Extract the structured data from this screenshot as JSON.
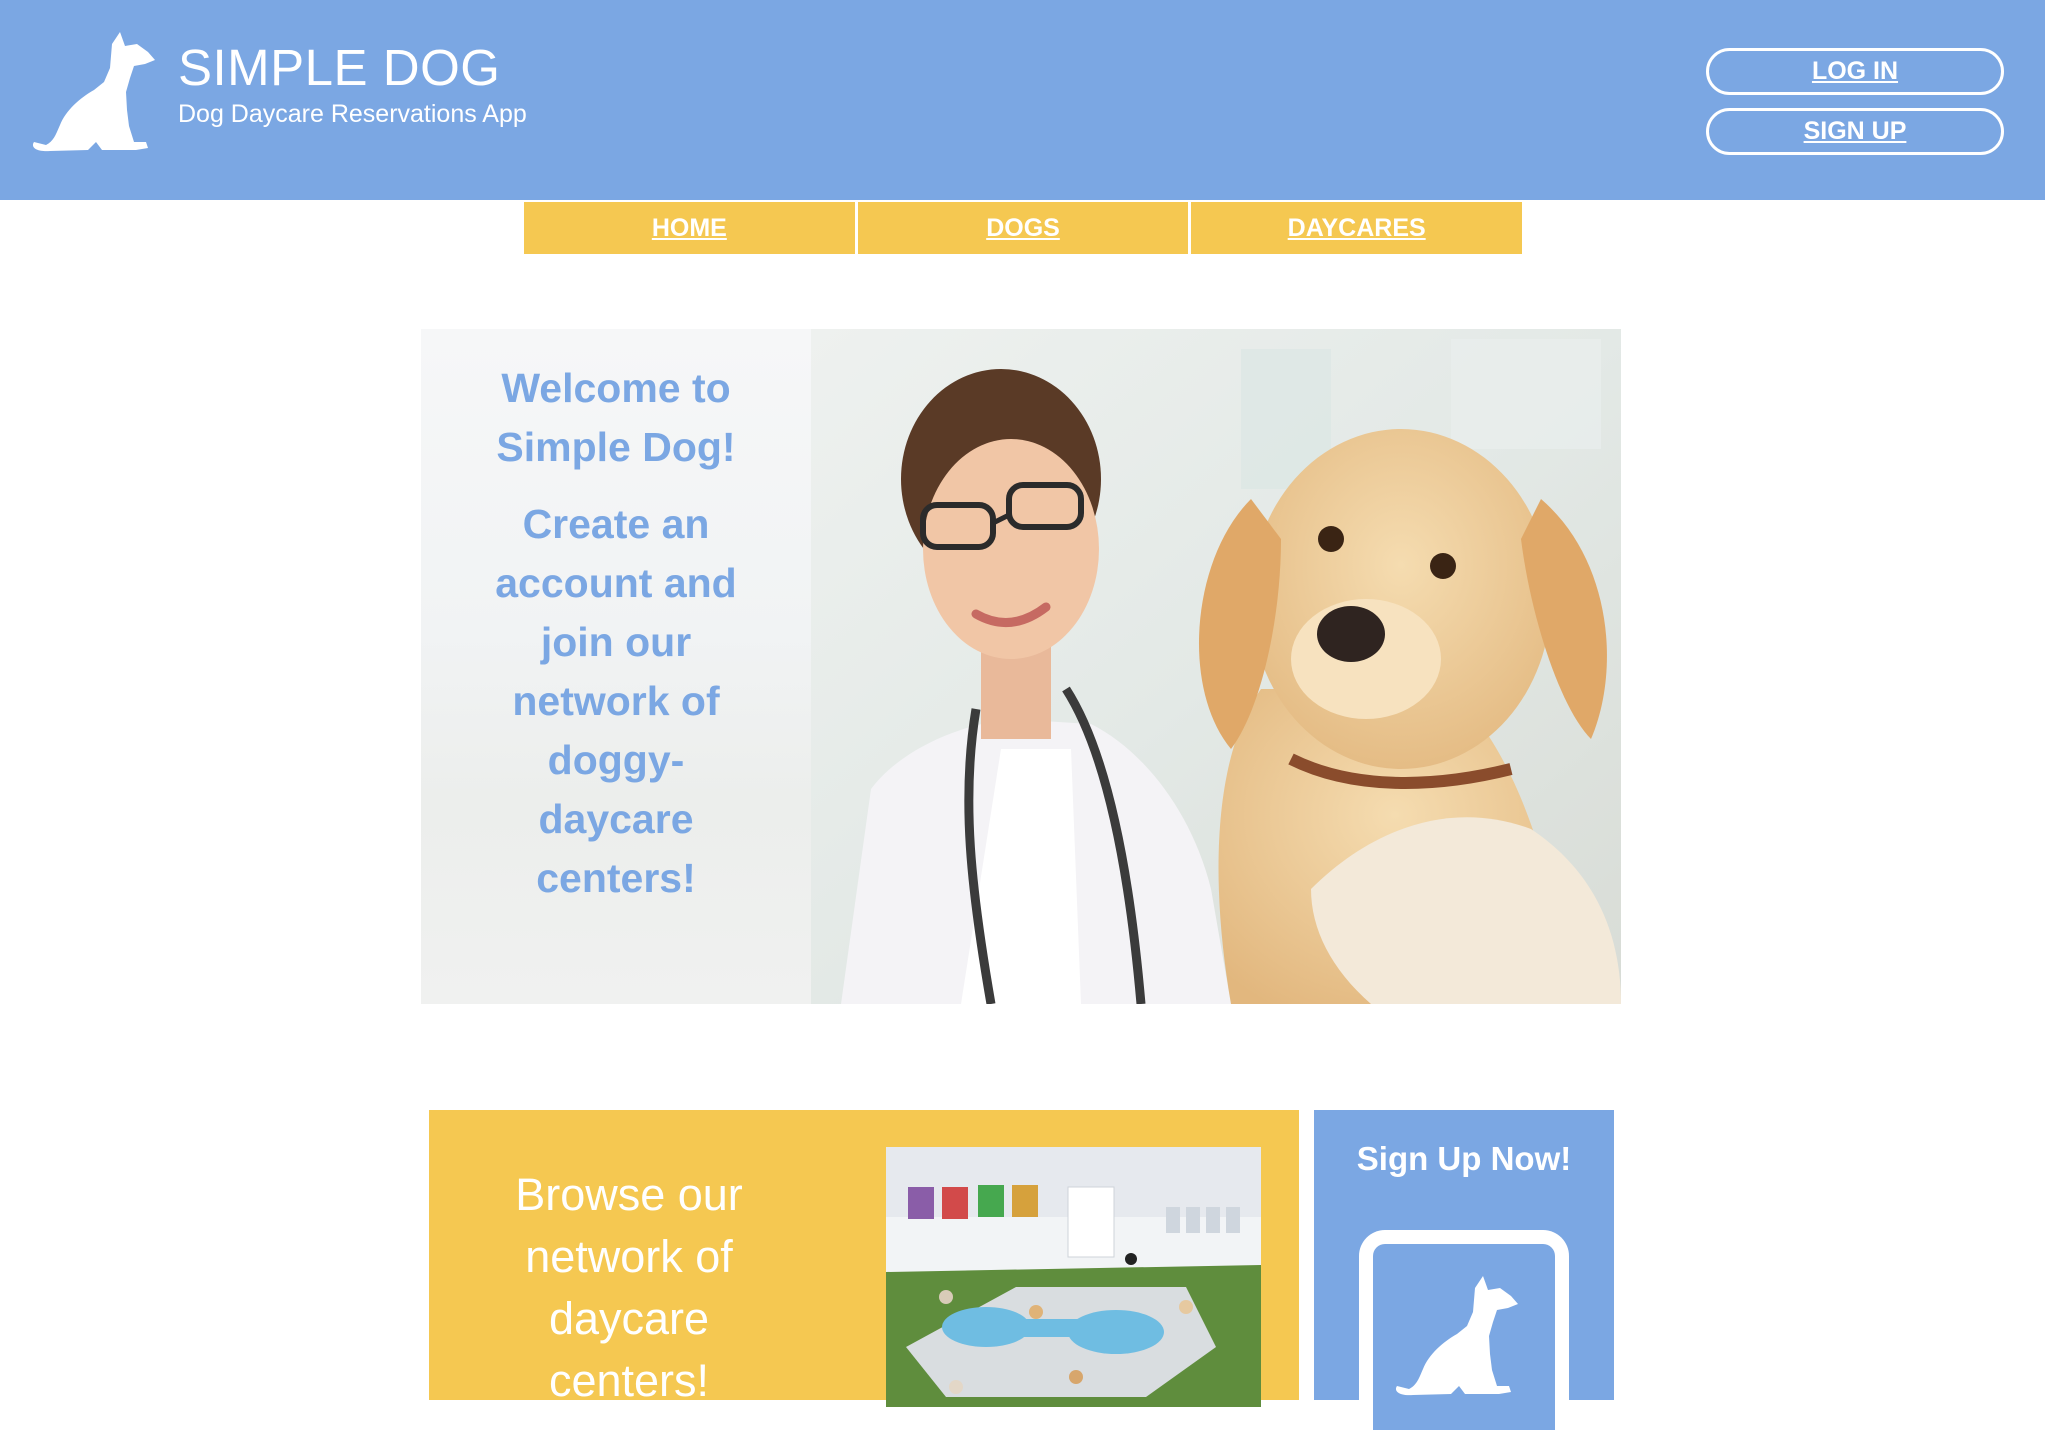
{
  "header": {
    "title": "SIMPLE DOG",
    "subtitle": "Dog Daycare Reservations App",
    "login_label": "LOG IN",
    "signup_label": "SIGN UP"
  },
  "nav": {
    "tabs": [
      "HOME",
      "DOGS",
      "DAYCARES"
    ]
  },
  "hero": {
    "welcome_lines": [
      "Welcome to",
      "Simple Dog!"
    ],
    "cta_lines": [
      "Create an",
      "account and",
      "join our",
      "network of",
      "doggy-",
      "daycare",
      "centers!"
    ]
  },
  "browse": {
    "text_lines": [
      "Browse our",
      "network of",
      "daycare",
      "centers!"
    ]
  },
  "signup_card": {
    "heading": "Sign Up Now!"
  },
  "icons": {
    "logo": "dog-silhouette-icon"
  },
  "colors": {
    "brand_blue": "#7ba7e3",
    "brand_yellow": "#f5c851",
    "white": "#ffffff"
  }
}
